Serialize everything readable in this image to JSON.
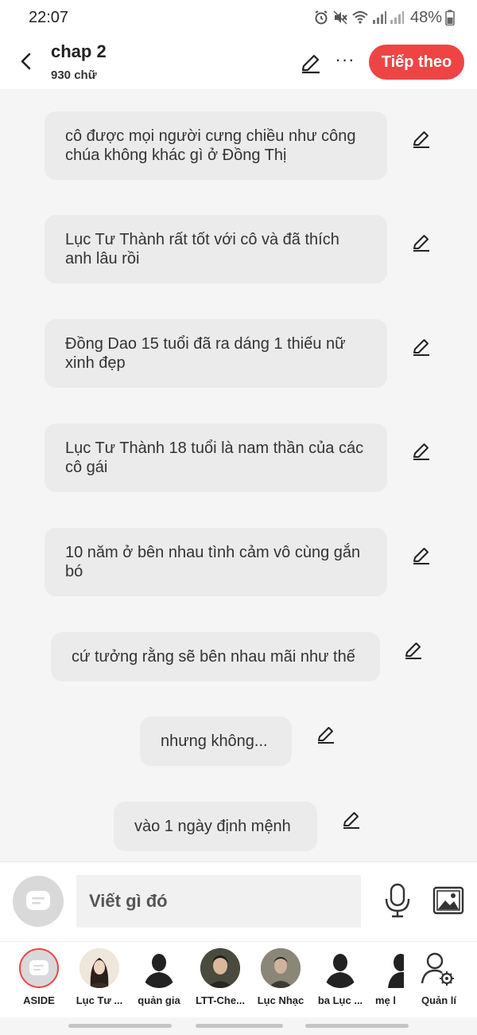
{
  "status_bar": {
    "time": "22:07",
    "battery": "48%"
  },
  "header": {
    "title": "chap 2",
    "word_count": "930 chữ",
    "next_label": "Tiếp theo",
    "more_label": "···"
  },
  "messages": [
    {
      "text": "cô được mọi người cưng chiều như công chúa không khác gì ở Đồng Thị"
    },
    {
      "text": "Lục Tư Thành rất tốt với cô và đã thích anh lâu rồi"
    },
    {
      "text": "Đồng Dao 15 tuổi đã ra dáng 1 thiếu nữ xinh đẹp"
    },
    {
      "text": "Lục Tư Thành 18 tuổi là nam thần của các cô gái"
    },
    {
      "text": "10 năm ở bên nhau tình cảm vô cùng gắn bó"
    },
    {
      "text": "cứ tưởng rằng sẽ bên nhau mãi như thế"
    },
    {
      "text": "nhưng không..."
    },
    {
      "text": "vào 1 ngày định mệnh"
    }
  ],
  "composer": {
    "placeholder": "Viết gì đó"
  },
  "characters": [
    {
      "name": "ASIDE"
    },
    {
      "name": "Lục Tư ..."
    },
    {
      "name": "quản gia"
    },
    {
      "name": "LTT-Che..."
    },
    {
      "name": "Lục Nhạc"
    },
    {
      "name": "ba Lục ..."
    },
    {
      "name": "mẹ l"
    },
    {
      "name": "Quản lí"
    }
  ],
  "colors": {
    "accent": "#ef4444",
    "bubble": "#ebebeb",
    "background": "#f5f5f5"
  }
}
